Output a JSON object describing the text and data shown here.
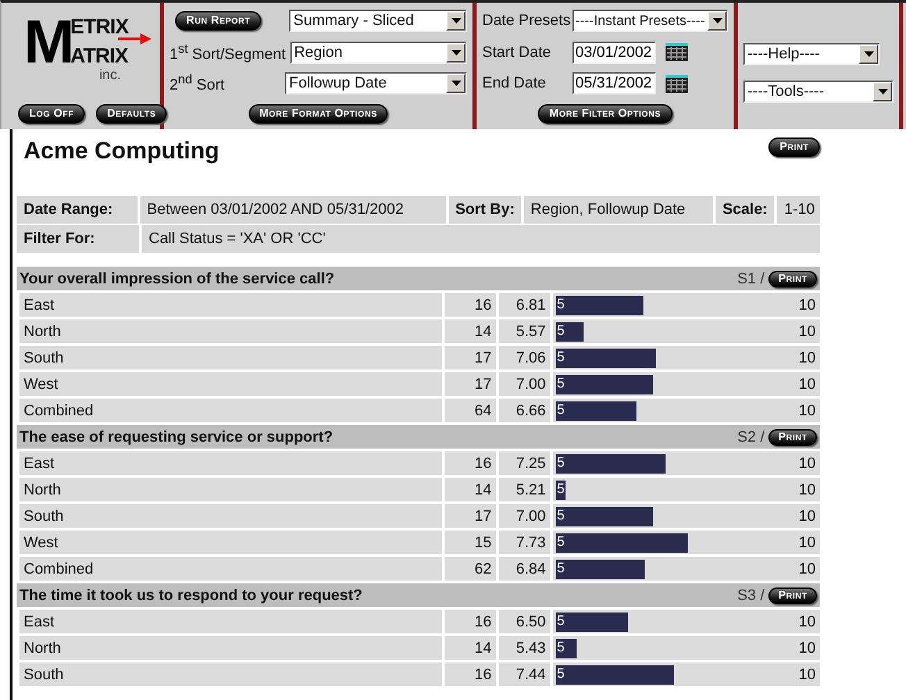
{
  "header": {
    "logo": {
      "line1": "ETRIX",
      "line2": "ATRIX",
      "initial": "M",
      "suffix": "inc."
    },
    "account_buttons": [
      "Log Off",
      "Defaults"
    ],
    "format": {
      "run_button": "Run Report",
      "report_type": "Summary - Sliced",
      "sort1_label": "1$^{st}$ Sort/Segment",
      "sort1_value": "Region",
      "sort2_label": "2$^{nd}$ Sort",
      "sort2_value": "Followup Date",
      "more_button": "More Format Options"
    },
    "filter": {
      "presets_label": "Date Presets",
      "presets_value": "----Instant Presets----",
      "start_label": "Start Date",
      "start_value": "03/01/2002",
      "end_label": "End Date",
      "end_value": "05/31/2002",
      "more_button": "More Filter Options"
    },
    "tools": {
      "help": "----Help----",
      "tools": "----Tools----"
    }
  },
  "report": {
    "title": "Acme Computing",
    "print_button": "Print",
    "info": {
      "date_range_label": "Date Range:",
      "date_range": "Between 03/01/2002 AND 05/31/2002",
      "sort_by_label": "Sort By:",
      "sort_by": "Region, Followup Date",
      "scale_label": "Scale:",
      "scale": "1-10",
      "filter_label": "Filter For:",
      "filter": "Call Status = 'XA' OR 'CC'"
    },
    "sections": [
      {
        "question": "Your overall impression of the service call?",
        "code": "S1 /",
        "print_button": "Print",
        "rows": [
          {
            "label": "East",
            "count": "16",
            "mean": "6.81",
            "bar_start": "5",
            "level": 0.362,
            "max": "10"
          },
          {
            "label": "North",
            "count": "14",
            "mean": "5.57",
            "bar_start": "5",
            "level": 0.114,
            "max": "10"
          },
          {
            "label": "South",
            "count": "17",
            "mean": "7.06",
            "bar_start": "5",
            "level": 0.412,
            "max": "10"
          },
          {
            "label": "West",
            "count": "17",
            "mean": "7.00",
            "bar_start": "5",
            "level": 0.4,
            "max": "10"
          },
          {
            "label": "Combined",
            "count": "64",
            "mean": "6.66",
            "bar_start": "5",
            "level": 0.332,
            "max": "10"
          }
        ]
      },
      {
        "question": "The ease of requesting service or support?",
        "code": "S2 /",
        "print_button": "Print",
        "rows": [
          {
            "label": "East",
            "count": "16",
            "mean": "7.25",
            "bar_start": "5",
            "level": 0.45,
            "max": "10"
          },
          {
            "label": "North",
            "count": "14",
            "mean": "5.21",
            "bar_start": "5",
            "level": 0.042,
            "max": "10"
          },
          {
            "label": "South",
            "count": "17",
            "mean": "7.00",
            "bar_start": "5",
            "level": 0.4,
            "max": "10"
          },
          {
            "label": "West",
            "count": "15",
            "mean": "7.73",
            "bar_start": "5",
            "level": 0.546,
            "max": "10"
          },
          {
            "label": "Combined",
            "count": "62",
            "mean": "6.84",
            "bar_start": "5",
            "level": 0.368,
            "max": "10"
          }
        ]
      },
      {
        "question": "The time it took us to respond to your request?",
        "code": "S3 /",
        "print_button": "Print",
        "rows": [
          {
            "label": "East",
            "count": "16",
            "mean": "6.50",
            "bar_start": "5",
            "level": 0.3,
            "max": "10"
          },
          {
            "label": "North",
            "count": "14",
            "mean": "5.43",
            "bar_start": "5",
            "level": 0.086,
            "max": "10"
          },
          {
            "label": "South",
            "count": "16",
            "mean": "7.44",
            "bar_start": "5",
            "level": 0.488,
            "max": "10"
          }
        ]
      }
    ]
  }
}
